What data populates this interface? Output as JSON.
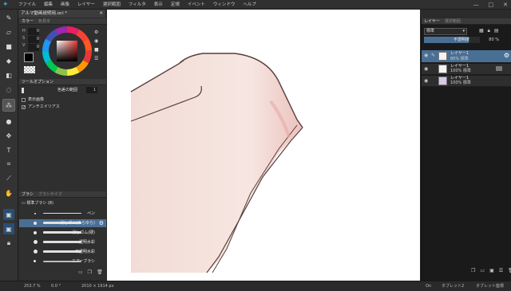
{
  "menubar": {
    "items": [
      "ファイル",
      "編集",
      "画像",
      "レイヤー",
      "選択範囲",
      "フィルタ",
      "表示",
      "定規",
      "イベント",
      "ウィンドウ",
      "ヘルプ"
    ],
    "minimize": "—",
    "maximize": "□",
    "close": "✕"
  },
  "document_tab": {
    "title": "アルマ動画説明用.ocl *",
    "close": "✕"
  },
  "color_panel": {
    "tabs": [
      "カラー",
      "色見本"
    ],
    "channels": [
      "H",
      "S",
      "V"
    ],
    "channel_values": [
      "0",
      "0",
      "0"
    ],
    "accent": "#e53935"
  },
  "tool_options": {
    "title": "ツールオプション",
    "range_label": "色差の範囲",
    "range_value": "1",
    "show_image_label": "表示画像",
    "antialias_label": "アンチエイリアス"
  },
  "brush_panel": {
    "tabs": [
      "ブラシ",
      "ブラシサイズ"
    ],
    "group": "標準ブラシ (8)",
    "items": [
      {
        "label": "ペン",
        "selected": false
      },
      {
        "label": "消しゴム(ゆらゆら)",
        "selected": true
      },
      {
        "label": "消しゴム(硬)",
        "selected": false
      },
      {
        "label": "透明水彩",
        "selected": false
      },
      {
        "label": "不透明水彩",
        "selected": false
      },
      {
        "label": "エアーブラシ",
        "selected": false
      }
    ]
  },
  "layer_panel": {
    "tabs": [
      "レイヤー",
      "選択範囲"
    ],
    "blend_mode": "標準",
    "opacity_label": "不透明度",
    "opacity_value": "80 %",
    "layers": [
      {
        "name": "レイヤー1",
        "mode": "80% 標準",
        "selected": true
      },
      {
        "name": "レイヤー1",
        "mode": "100% 標準",
        "selected": false
      },
      {
        "name": "レイヤー1",
        "mode": "100% 標準",
        "selected": false
      }
    ]
  },
  "statusbar": {
    "zoom": "253.7 %",
    "rotation": "0.0 °",
    "size": "2010 × 1914 px",
    "on": "On",
    "tablet1": "タブレット2",
    "tablet2": "タブレット座標"
  },
  "tools": [
    "pen-icon",
    "eraser-icon",
    "shape-icon",
    "fill-icon",
    "gradient-icon",
    "lasso-icon",
    "wand-icon",
    "blur-icon",
    "move-icon",
    "text-icon",
    "crop-icon",
    "eyedropper-icon",
    "hand-icon"
  ]
}
